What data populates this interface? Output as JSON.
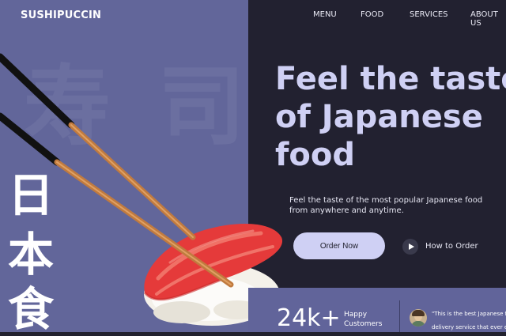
{
  "brand": "SUSHIPUCCIN",
  "nav": [
    "MENU",
    "FOOD",
    "SERVICES",
    "ABOUT US"
  ],
  "watermark": [
    "寿",
    "司"
  ],
  "kanji": [
    "日",
    "本",
    "食"
  ],
  "hero": {
    "title_lines": [
      "Feel the taste",
      "of Japanese",
      "food"
    ],
    "subtitle": "Feel the taste of the most popular Japanese food from anywhere and anytime."
  },
  "buttons": {
    "order": "Order Now",
    "how_to_order": "How to Order"
  },
  "stats": {
    "value": "24k+",
    "label_line1": "Happy",
    "label_line2": "Customers"
  },
  "testimonial": {
    "line1": "\"This is the best Japanese food",
    "line2": "delivery service that ever exist"
  },
  "colors": {
    "left_panel": "#62669a",
    "right_panel": "#222130",
    "accent": "#cfd0f4",
    "tuna": "#e53a3a"
  }
}
